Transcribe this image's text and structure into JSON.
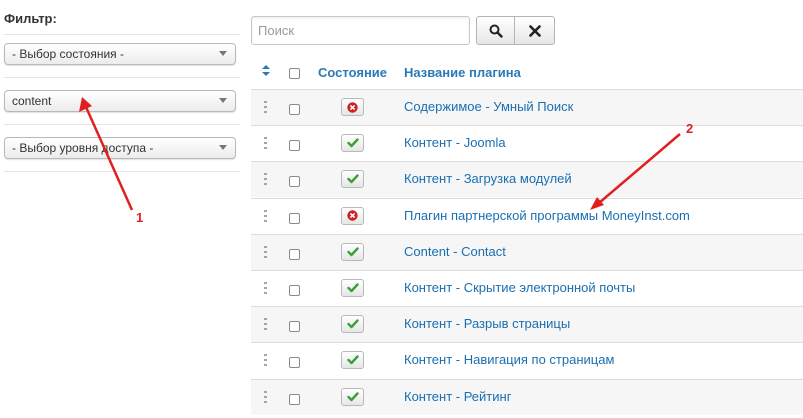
{
  "filter": {
    "title": "Фильтр:",
    "state_select": "- Выбор состояния -",
    "type_select": "content",
    "access_select": "- Выбор уровня доступа -"
  },
  "search": {
    "placeholder": "Поиск",
    "value": "",
    "search_icon": "search-icon",
    "clear_icon": "close-icon"
  },
  "table": {
    "headers": {
      "state": "Состояние",
      "name": "Название плагина"
    },
    "rows": [
      {
        "state": "disabled",
        "name": "Содержимое - Умный Поиск"
      },
      {
        "state": "enabled",
        "name": "Контент - Joomla"
      },
      {
        "state": "enabled",
        "name": "Контент - Загрузка модулей"
      },
      {
        "state": "disabled",
        "name": "Плагин партнерской программы MoneyInst.com"
      },
      {
        "state": "enabled",
        "name": "Content - Contact"
      },
      {
        "state": "enabled",
        "name": "Контент - Скрытие электронной почты"
      },
      {
        "state": "enabled",
        "name": "Контент - Разрыв страницы"
      },
      {
        "state": "enabled",
        "name": "Контент - Навигация по страницам"
      },
      {
        "state": "enabled",
        "name": "Контент - Рейтинг"
      }
    ]
  },
  "annotations": {
    "label_1": "1",
    "label_2": "2",
    "color": "#e02020"
  },
  "colors": {
    "link": "#1a6fb0",
    "header": "#2a7ab8",
    "enabled": "#3aa03a",
    "disabled": "#cc2222"
  }
}
